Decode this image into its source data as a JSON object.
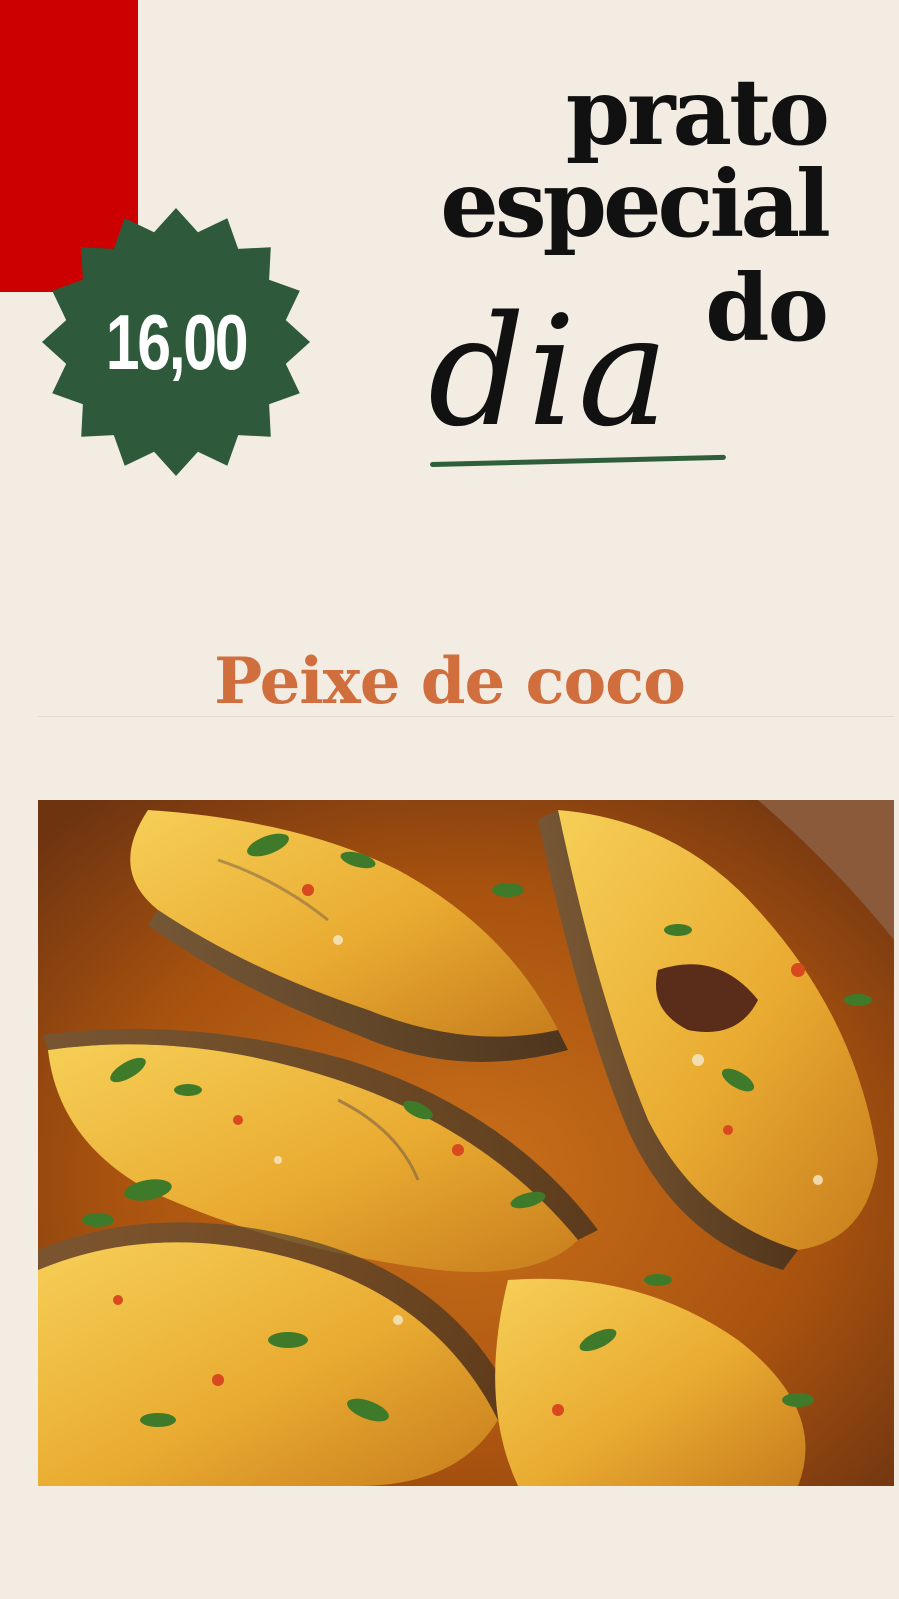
{
  "colors": {
    "background": "#f2ece3",
    "accent_red": "#cc0000",
    "badge_green": "#2e5a3b",
    "title_text": "#111111",
    "dish_name": "#d06f3d"
  },
  "badge": {
    "price": "16,00",
    "shape": "starburst-badge"
  },
  "title": {
    "line1": "prato",
    "line2": "especial",
    "line3": "do",
    "line4": "dia"
  },
  "dish": {
    "name": "Peixe de coco"
  },
  "photo": {
    "subject": "fish-steaks-in-coconut-sauce-image"
  }
}
